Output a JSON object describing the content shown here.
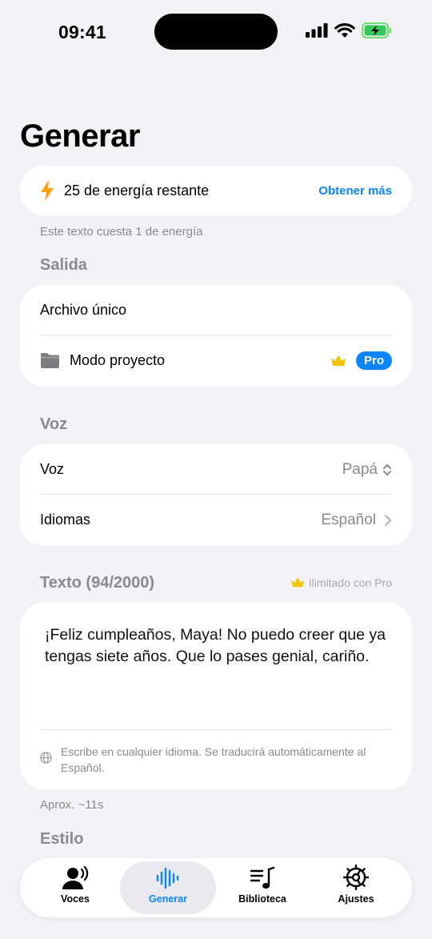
{
  "status_bar": {
    "time": "09:41"
  },
  "title": "Generar",
  "energy": {
    "text": "25 de energía restante",
    "link": "Obtener más",
    "cost_note": "Este texto cuesta 1 de energía"
  },
  "output": {
    "header": "Salida",
    "single_file": "Archivo único",
    "project_mode": "Modo proyecto",
    "pro_badge": "Pro"
  },
  "voice_section": {
    "header": "Voz",
    "voice_label": "Voz",
    "voice_value": "Papá",
    "languages_label": "Idiomas",
    "languages_value": "Español"
  },
  "text_section": {
    "header": "Texto (94/2000)",
    "unlimited_note": "Ilimitado con Pro",
    "content": "¡Feliz cumpleaños, Maya! No puedo creer que ya tengas siete años. Que lo pases genial, cariño.",
    "hint": "Escribe en cualquier idioma. Se traducirá automáticamente al Español.",
    "duration": "Aprox. ~11s"
  },
  "style_section": {
    "header": "Estilo"
  },
  "tabs": [
    {
      "label": "Voces",
      "icon": "voices-icon"
    },
    {
      "label": "Generar",
      "icon": "waveform-icon",
      "active": true
    },
    {
      "label": "Biblioteca",
      "icon": "music-list-icon"
    },
    {
      "label": "Ajustes",
      "icon": "gear-icon"
    }
  ],
  "colors": {
    "accent": "#0a84ff",
    "energy": "#ff9f0a",
    "crown": "#f5c400",
    "background": "#f2f2f7"
  }
}
